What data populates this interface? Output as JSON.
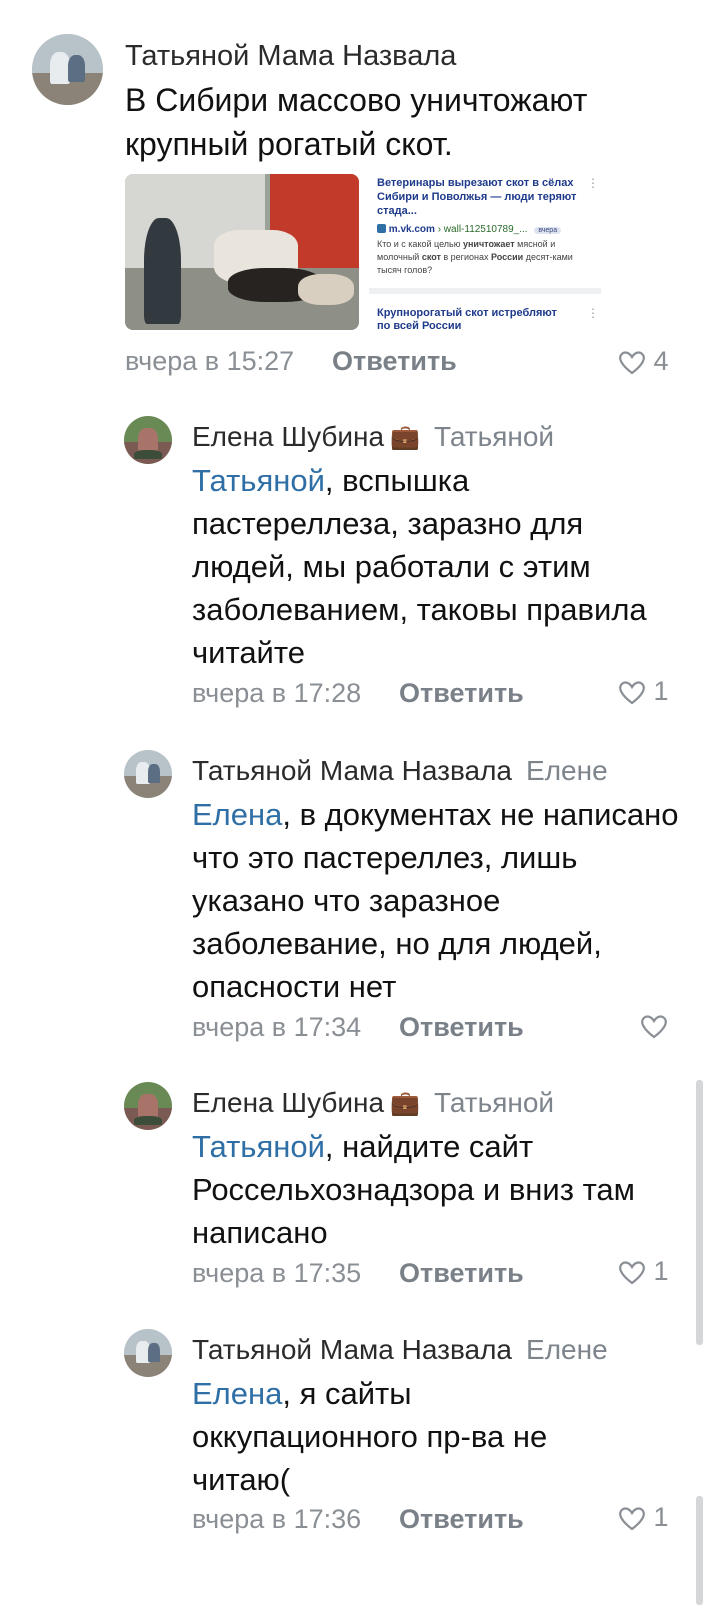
{
  "colors": {
    "mention": "#2f6fa6",
    "meta": "#8a8f95",
    "text": "#111111"
  },
  "post": {
    "avatar_icon": "user-avatar",
    "author": "Татьяной Мама Назвала",
    "text": "В Сибири массово уничтожают крупный рогатый скот.",
    "time": "вчера в 15:27",
    "reply_label": "Ответить",
    "likes": "4",
    "attachment": {
      "title": "Ветеринары вырезают скот в сёлах Сибири и Поволжья — люди теряют стада...",
      "source_domain": "m.vk.com",
      "source_path": "› wall-112510789_...",
      "badge": "вчера",
      "description_parts": [
        "Кто и с какой целью ",
        "уничтожает",
        " мясной и молочный ",
        "скот",
        " в регионах ",
        "России",
        " десят-ками тысяч голов?"
      ],
      "second_title": "Крупнорогатый скот истребляют",
      "second_title_cut": "по всей России"
    }
  },
  "replies": [
    {
      "author": "Елена Шубина",
      "author_icon": "briefcase-icon",
      "reply_to": "Татьяной",
      "mention": "Татьяной",
      "text": ", вспышка пастереллеза, заразно для людей, мы работали с этим заболеванием, таковы правила читайте",
      "time": "вчера в 17:28",
      "reply_label": "Ответить",
      "likes": "1"
    },
    {
      "author": "Татьяной Мама Назвала",
      "reply_to": "Елене",
      "mention": "Елена",
      "text": ", в документах не написано что это пастереллез, лишь указано что заразное заболевание, но для людей, опасности нет",
      "time": "вчера в 17:34",
      "reply_label": "Ответить",
      "likes": ""
    },
    {
      "author": "Елена Шубина",
      "author_icon": "briefcase-icon",
      "reply_to": "Татьяной",
      "mention": "Татьяной",
      "text": ", найдите сайт Россельхознадзора и вниз там написано",
      "time": "вчера в 17:35",
      "reply_label": "Ответить",
      "likes": "1"
    },
    {
      "author": "Татьяной Мама Назвала",
      "reply_to": "Елене",
      "mention": "Елена",
      "text": ", я сайты оккупационного пр-ва не читаю(",
      "time": "вчера в 17:36",
      "reply_label": "Ответить",
      "likes": "1"
    }
  ]
}
